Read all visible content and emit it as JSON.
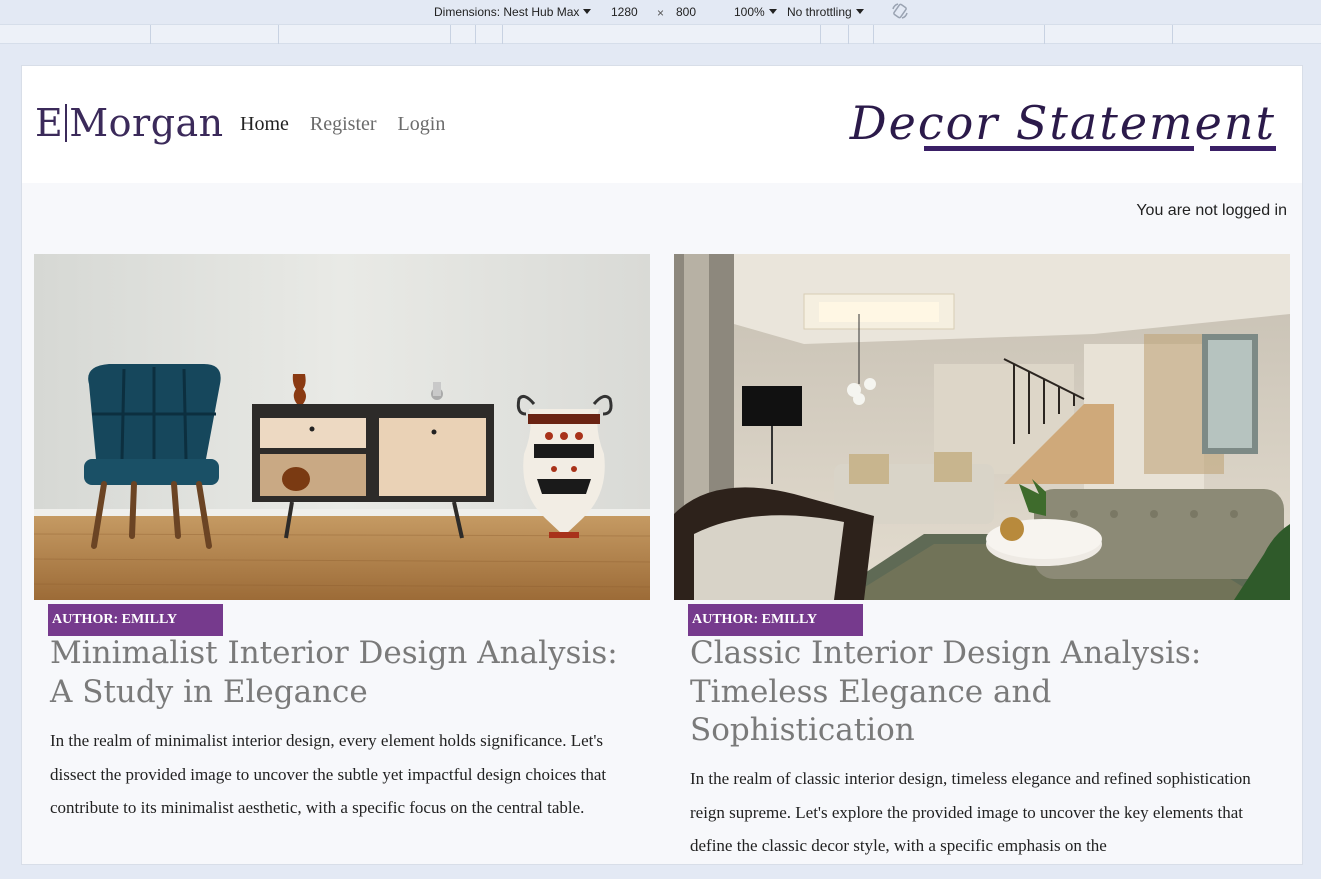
{
  "devtools": {
    "device_label": "Dimensions: Nest Hub Max",
    "width": "1280",
    "times": "×",
    "height": "800",
    "zoom": "100%",
    "throttle": "No throttling",
    "rotate_icon": "rotate-icon"
  },
  "site": {
    "logo_left": "E",
    "logo_right": "Morgan",
    "nav": {
      "home": "Home",
      "register": "Register",
      "login": "Login"
    },
    "brand": "Decor Statement",
    "login_status": "You are not logged in"
  },
  "posts": [
    {
      "author": "AUTHOR: EMILLY",
      "title": "Minimalist Interior Design Analysis: A Study in Elegance",
      "body": "In the realm of minimalist interior design, every element holds significance. Let's dissect the provided image to uncover the subtle yet impactful design choices that contribute to its minimalist aesthetic, with a specific focus on the central table."
    },
    {
      "author": "AUTHOR: EMILLY",
      "title": "Classic Interior Design Analysis: Timeless Elegance and Sophistication",
      "body": "In the realm of classic interior design, timeless elegance and refined sophistication reign supreme. Let's explore the provided image to uncover the key elements that define the classic decor style, with a specific emphasis on the"
    }
  ],
  "colors": {
    "accent": "#763a8d",
    "logo": "#3b2a5a",
    "brand_underline": "#3a1f66",
    "background": "#f7f8fb"
  }
}
